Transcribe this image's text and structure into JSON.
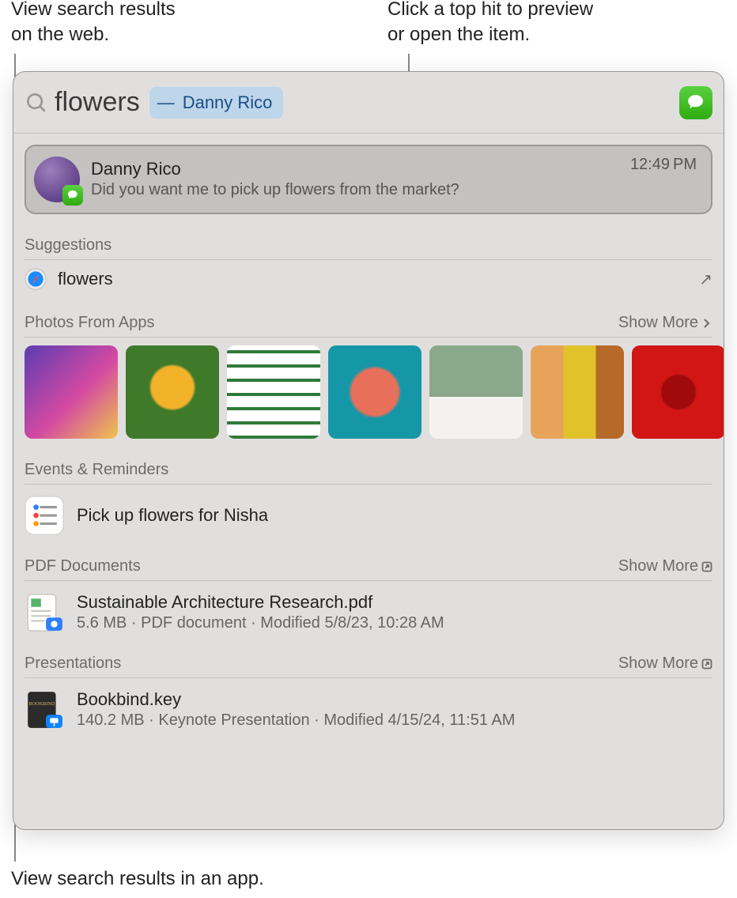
{
  "callouts": {
    "top_left": "View search results\non the web.",
    "top_right": "Click a top hit to preview\nor open the item.",
    "bottom": "View search results in an app."
  },
  "search": {
    "query": "flowers",
    "completion_dash": "—",
    "completion_name": "Danny Rico"
  },
  "top_hit": {
    "title": "Danny Rico",
    "preview": "Did you want me to pick up flowers from the market?",
    "time": "12:49 PM"
  },
  "sections": {
    "suggestions": {
      "header": "Suggestions",
      "item": "flowers"
    },
    "photos": {
      "header": "Photos From Apps",
      "show_more": "Show More"
    },
    "events": {
      "header": "Events & Reminders",
      "item": "Pick up flowers for Nisha"
    },
    "pdf": {
      "header": "PDF Documents",
      "show_more": "Show More",
      "title": "Sustainable Architecture Research.pdf",
      "meta": "5.6 MB · PDF document · Modified 5/8/23, 10:28 AM"
    },
    "presentations": {
      "header": "Presentations",
      "show_more": "Show More",
      "title": "Bookbind.key",
      "meta": "140.2 MB · Keynote Presentation · Modified 4/15/24, 11:51 AM"
    }
  }
}
